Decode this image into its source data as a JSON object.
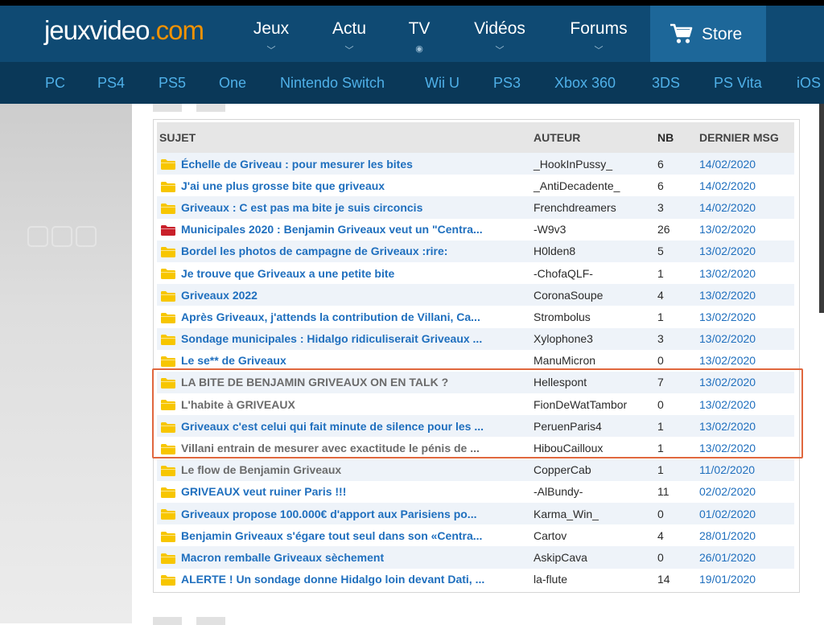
{
  "header": {
    "logo_main": "jeuxvideo",
    "logo_tld": ".com",
    "nav": [
      {
        "label": "Jeux",
        "chevron": "﹀"
      },
      {
        "label": "Actu",
        "chevron": "﹀"
      },
      {
        "label": "TV",
        "chevron": "◉"
      },
      {
        "label": "Vidéos",
        "chevron": "﹀"
      },
      {
        "label": "Forums",
        "chevron": "﹀"
      }
    ],
    "store_label": "Store",
    "platforms": [
      "PC",
      "PS4",
      "PS5",
      "One",
      "Nintendo Switch",
      "Wii U",
      "PS3",
      "Xbox 360",
      "3DS",
      "PS Vita",
      "iOS"
    ]
  },
  "colors": {
    "header_bg": "#0f4a73",
    "subnav_bg": "#0a3858",
    "link_blue": "#1f6fbe",
    "read_gray": "#6b6b6b",
    "highlight": "#e0673e",
    "folder_yellow": "#f7c600",
    "folder_red": "#c9202a"
  },
  "table": {
    "headers": {
      "subject": "SUJET",
      "author": "AUTEUR",
      "count": "NB",
      "last": "DERNIER MSG"
    },
    "rows": [
      {
        "icon": "folder-icon",
        "subject": "Échelle de Griveau : pour mesurer les bites",
        "author": "_HookInPussy_",
        "count": "6",
        "date": "14/02/2020",
        "read": false
      },
      {
        "icon": "folder-icon",
        "subject": "J'ai une plus grosse bite que griveaux",
        "author": "_AntiDecadente_",
        "count": "6",
        "date": "14/02/2020",
        "read": false
      },
      {
        "icon": "folder-icon",
        "subject": "Griveaux : C est pas ma bite je suis circoncis",
        "author": "Frenchdreamers",
        "count": "3",
        "date": "14/02/2020",
        "read": false
      },
      {
        "icon": "folder-red-icon",
        "subject": "Municipales 2020 : Benjamin Griveaux veut un \"Centra...",
        "author": "-W9v3",
        "count": "26",
        "date": "13/02/2020",
        "read": false
      },
      {
        "icon": "folder-icon",
        "subject": "Bordel les photos de campagne de Griveaux :rire:",
        "author": "H0lden8",
        "count": "5",
        "date": "13/02/2020",
        "read": false
      },
      {
        "icon": "folder-icon",
        "subject": "Je trouve que Griveaux a une petite bite",
        "author": "-ChofaQLF-",
        "count": "1",
        "date": "13/02/2020",
        "read": false
      },
      {
        "icon": "folder-icon",
        "subject": "Griveaux 2022",
        "author": "CoronaSoupe",
        "count": "4",
        "date": "13/02/2020",
        "read": false
      },
      {
        "icon": "folder-icon",
        "subject": "Après Griveaux, j'attends la contribution de Villani, Ca...",
        "author": "Strombolus",
        "count": "1",
        "date": "13/02/2020",
        "read": false
      },
      {
        "icon": "folder-icon",
        "subject": "Sondage municipales : Hidalgo ridiculiserait Griveaux ...",
        "author": "Xylophone3",
        "count": "3",
        "date": "13/02/2020",
        "read": false
      },
      {
        "icon": "folder-icon",
        "subject": "Le se** de Griveaux",
        "author": "ManuMicron",
        "count": "0",
        "date": "13/02/2020",
        "read": false
      },
      {
        "icon": "folder-icon",
        "subject": "LA BITE DE BENJAMIN GRIVEAUX ON EN TALK ?",
        "author": "Hellespont",
        "count": "7",
        "date": "13/02/2020",
        "read": true
      },
      {
        "icon": "folder-icon",
        "subject": "L'habite à GRIVEAUX",
        "author": "FionDeWatTambor",
        "count": "0",
        "date": "13/02/2020",
        "read": true
      },
      {
        "icon": "folder-icon",
        "subject": "Griveaux c'est celui qui fait minute de silence pour les ...",
        "author": "PeruenParis4",
        "count": "1",
        "date": "13/02/2020",
        "read": false
      },
      {
        "icon": "folder-icon",
        "subject": "Villani entrain de mesurer avec exactitude le pénis de ...",
        "author": "HibouCailloux",
        "count": "1",
        "date": "13/02/2020",
        "read": true
      },
      {
        "icon": "folder-icon",
        "subject": "Le flow de Benjamin Griveaux",
        "author": "CopperCab",
        "count": "1",
        "date": "11/02/2020",
        "read": true
      },
      {
        "icon": "folder-icon",
        "subject": "GRIVEAUX veut ruiner Paris !!!",
        "author": "-AlBundy-",
        "count": "11",
        "date": "02/02/2020",
        "read": false
      },
      {
        "icon": "folder-icon",
        "subject": "Griveaux propose 100.000€ d'apport aux Parisiens po...",
        "author": "Karma_Win_",
        "count": "0",
        "date": "01/02/2020",
        "read": false
      },
      {
        "icon": "folder-icon",
        "subject": "Benjamin Griveaux s'égare tout seul dans son «Centra...",
        "author": "Cartov",
        "count": "4",
        "date": "28/01/2020",
        "read": false
      },
      {
        "icon": "folder-icon",
        "subject": "Macron remballe Griveaux sèchement",
        "author": "AskipCava",
        "count": "0",
        "date": "26/01/2020",
        "read": false
      },
      {
        "icon": "folder-icon",
        "subject": "ALERTE ! Un sondage donne Hidalgo loin devant Dati, ...",
        "author": "la-flute",
        "count": "14",
        "date": "19/01/2020",
        "read": false
      }
    ]
  }
}
